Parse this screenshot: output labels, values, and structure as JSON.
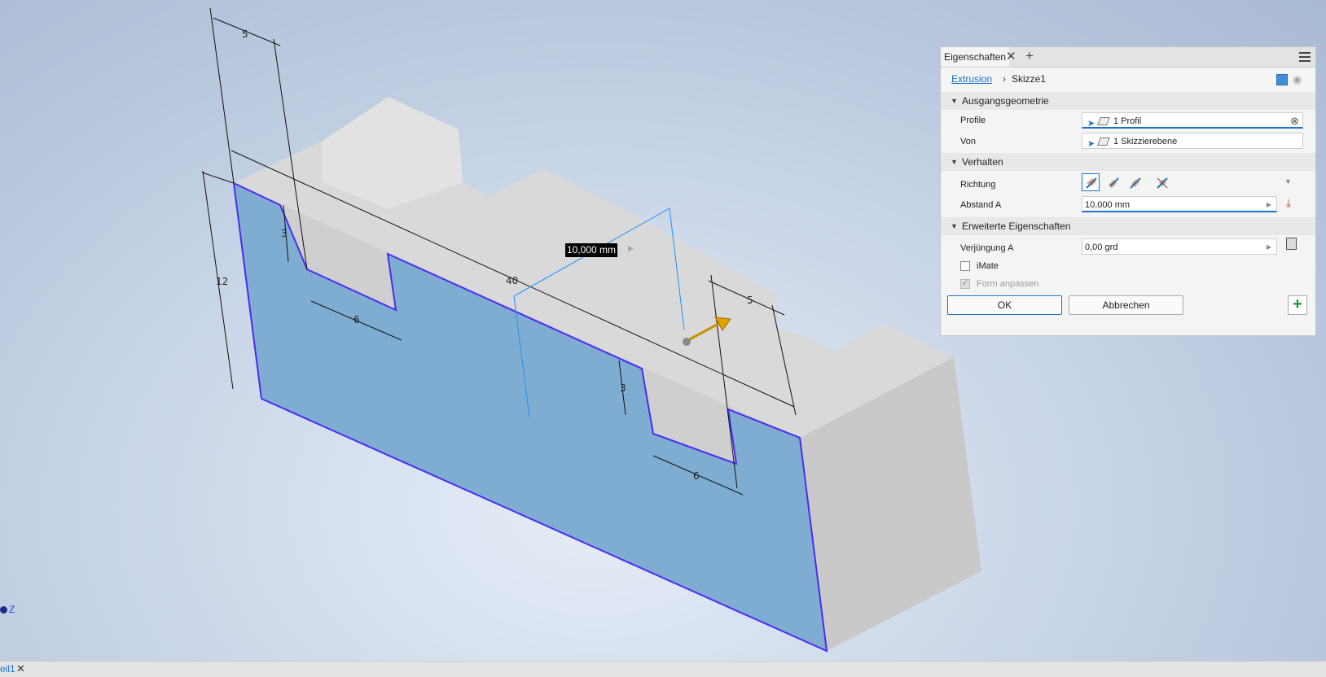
{
  "dimensions": {
    "top_left_width": "5",
    "left_slot_depth": "3",
    "left_slot_width": "6",
    "overall_length": "40",
    "height": "12",
    "right_slot_width_top": "5",
    "right_slot_depth": "3",
    "right_slot_width": "6"
  },
  "extrude_preview": {
    "value": "10,000 mm"
  },
  "axis": {
    "z_label": "Z"
  },
  "doc_tab": {
    "label": "eil1"
  },
  "panel": {
    "tab_label": "Eigenschaften",
    "breadcrumb": {
      "feature": "Extrusion",
      "sketch": "Skizze1"
    },
    "sections": {
      "input_geometry": "Ausgangsgeometrie",
      "behavior": "Verhalten",
      "advanced": "Erweiterte Eigenschaften"
    },
    "rows": {
      "profile_label": "Profile",
      "profile_value": "1 Profil",
      "from_label": "Von",
      "from_value": "1 Skizzierebene",
      "direction_label": "Richtung",
      "distance_label": "Abstand A",
      "distance_value": "10,000 mm",
      "taper_label": "Verjüngung A",
      "taper_value": "0,00 grd"
    },
    "checkboxes": {
      "imate": "iMate",
      "match_shape": "Form anpassen"
    },
    "buttons": {
      "ok": "OK",
      "cancel": "Abbrechen"
    }
  }
}
